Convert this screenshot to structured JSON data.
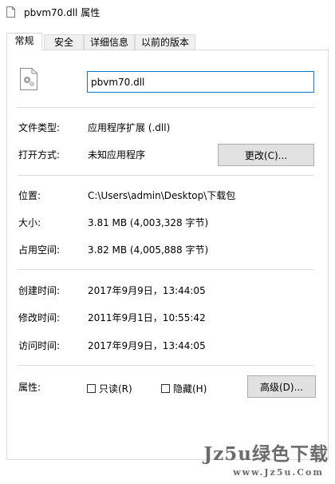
{
  "window": {
    "title": "pbvm70.dll 属性",
    "file_name_value": "pbvm70.dll"
  },
  "tabs": [
    {
      "label": "常规",
      "active": true
    },
    {
      "label": "安全",
      "active": false
    },
    {
      "label": "详细信息",
      "active": false
    },
    {
      "label": "以前的版本",
      "active": false
    }
  ],
  "props": {
    "type_label": "文件类型:",
    "type_value": "应用程序扩展 (.dll)",
    "open_label": "打开方式:",
    "open_value": "未知应用程序",
    "change_button": "更改(C)...",
    "location_label": "位置:",
    "location_value": "C:\\Users\\admin\\Desktop\\下载包",
    "size_label": "大小:",
    "size_value": "3.81 MB (4,003,328 字节)",
    "disk_label": "占用空间:",
    "disk_value": "3.82 MB (4,005,888 字节)",
    "created_label": "创建时间:",
    "created_value": "2017年9月9日，13:44:05",
    "modified_label": "修改时间:",
    "modified_value": "2011年9月1日，10:55:42",
    "accessed_label": "访问时间:",
    "accessed_value": "2017年9月9日，13:44:05",
    "attributes_label": "属性:",
    "readonly_label": "只读(R)",
    "hidden_label": "隐藏(H)",
    "advanced_button": "高级(D)..."
  },
  "watermark": {
    "logo_text": "Jz5u绿色下载",
    "url_text": "www.Jz5u.Com"
  },
  "icons": {
    "title_icon": "document-icon",
    "file_icon": "dll-file-gear-icon"
  }
}
